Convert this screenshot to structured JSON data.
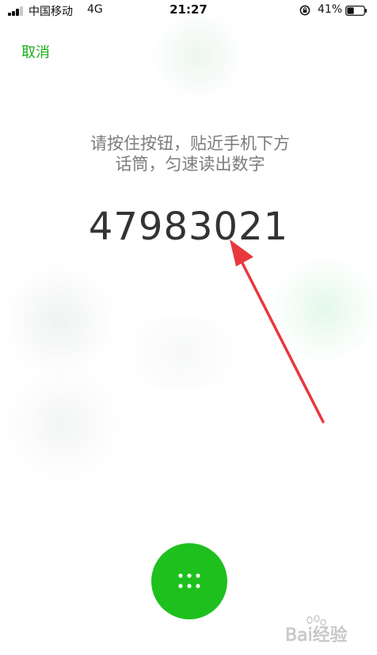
{
  "status_bar": {
    "carrier": "中国移动",
    "network": "4G",
    "time": "21:27",
    "battery_percent": "41%",
    "battery_level": 0.41,
    "signal_bars": 3,
    "icons": [
      "signal-bars-icon",
      "rotation-lock-icon",
      "battery-icon"
    ]
  },
  "nav": {
    "cancel_label": "取消"
  },
  "main": {
    "instruction_line1": "请按住按钮，贴近手机下方",
    "instruction_line2": "话筒，匀速读出数字",
    "digits": "47983021"
  },
  "record_button": {
    "icon": "keypad-dots-icon"
  },
  "watermark": {
    "text": "Bai经验",
    "icon": "baidu-paw-logo"
  },
  "colors": {
    "accent": "#1aad19",
    "button": "#1ec01e",
    "instruction_text": "#7c7c7c",
    "digits_text": "#333333",
    "arrow": "#e8383d"
  }
}
